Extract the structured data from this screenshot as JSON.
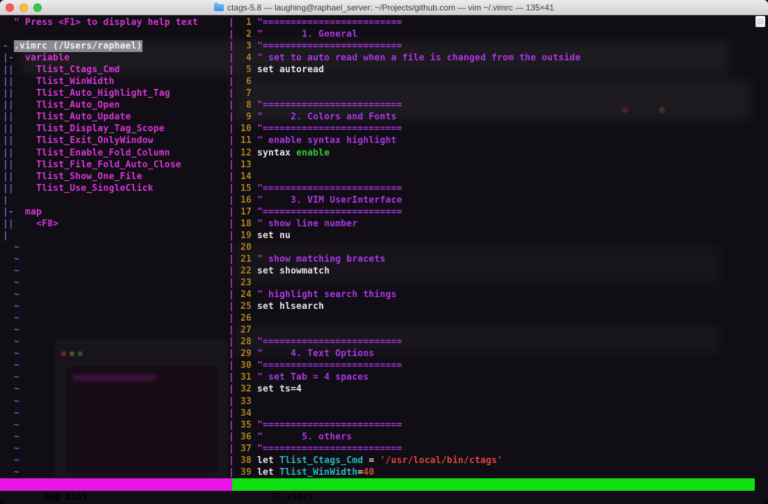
{
  "window": {
    "title": "ctags-5.8 — laughing@raphael_server: ~/Projects/github.com — vim ~/.vimrc — 135×41"
  },
  "colors": {
    "terminal_bg": "#100d14",
    "foreground": "#e8e5ea",
    "comment": "#ab38e4",
    "tag": "#d836d8",
    "line_number": "#a8811c",
    "green": "#2ed02e",
    "cyan": "#2cb8b8",
    "red": "#e0493c",
    "nontext": "#6f5bd6",
    "fold_column": "#7a5fd0",
    "divider": "#cf36d8",
    "file_highlight_bg": "#8e8a92",
    "status_taglist_bg": "#e816e8",
    "status_vimrc_bg": "#0fe00f"
  },
  "divider_char": "|",
  "taglist": {
    "rows": [
      {
        "fold": "",
        "text": "\" Press <F1> to display help text",
        "style": "comment"
      },
      {
        "fold": "",
        "text": "",
        "style": "tag"
      },
      {
        "fold": "-",
        "text": ".vimrc (/Users/raphael)",
        "style": "file"
      },
      {
        "fold": "|-",
        "text": "  variable",
        "style": "tag"
      },
      {
        "fold": "||",
        "text": "    Tlist_Ctags_Cmd",
        "style": "tag"
      },
      {
        "fold": "||",
        "text": "    Tlist_WinWidth",
        "style": "tag"
      },
      {
        "fold": "||",
        "text": "    Tlist_Auto_Highlight_Tag",
        "style": "tag"
      },
      {
        "fold": "||",
        "text": "    Tlist_Auto_Open",
        "style": "tag"
      },
      {
        "fold": "||",
        "text": "    Tlist_Auto_Update",
        "style": "tag"
      },
      {
        "fold": "||",
        "text": "    Tlist_Display_Tag_Scope",
        "style": "tag"
      },
      {
        "fold": "||",
        "text": "    Tlist_Exit_OnlyWindow",
        "style": "tag"
      },
      {
        "fold": "||",
        "text": "    Tlist_Enable_Fold_Column",
        "style": "tag"
      },
      {
        "fold": "||",
        "text": "    Tlist_File_Fold_Auto_Close",
        "style": "tag"
      },
      {
        "fold": "||",
        "text": "    Tlist_Show_One_File",
        "style": "tag"
      },
      {
        "fold": "||",
        "text": "    Tlist_Use_SingleClick",
        "style": "tag"
      },
      {
        "fold": "|",
        "text": "",
        "style": "tag"
      },
      {
        "fold": "|-",
        "text": "  map",
        "style": "tag"
      },
      {
        "fold": "||",
        "text": "    <F8>",
        "style": "tag"
      },
      {
        "fold": "|",
        "text": "",
        "style": "tag"
      }
    ],
    "empty_marker": "~",
    "empty_rows": 20
  },
  "editor": {
    "lines": [
      {
        "num": 1,
        "segments": [
          {
            "t": "\"=========================",
            "c": "cm"
          }
        ]
      },
      {
        "num": 2,
        "segments": [
          {
            "t": "\"       1. General",
            "c": "cm"
          }
        ]
      },
      {
        "num": 3,
        "segments": [
          {
            "t": "\"=========================",
            "c": "cm"
          }
        ]
      },
      {
        "num": 4,
        "segments": [
          {
            "t": "\" set to auto read when a file is changed from the outside",
            "c": "cm"
          }
        ]
      },
      {
        "num": 5,
        "segments": [
          {
            "t": "set autoread",
            "c": "tx"
          }
        ]
      },
      {
        "num": 6,
        "segments": []
      },
      {
        "num": 7,
        "segments": []
      },
      {
        "num": 8,
        "segments": [
          {
            "t": "\"=========================",
            "c": "cm"
          }
        ]
      },
      {
        "num": 9,
        "segments": [
          {
            "t": "\"     2. Colors and Fonts",
            "c": "cm"
          }
        ]
      },
      {
        "num": 10,
        "segments": [
          {
            "t": "\"=========================",
            "c": "cm"
          }
        ]
      },
      {
        "num": 11,
        "segments": [
          {
            "t": "\" enable syntax highlight",
            "c": "cm"
          }
        ]
      },
      {
        "num": 12,
        "segments": [
          {
            "t": "syntax ",
            "c": "tx"
          },
          {
            "t": "enable",
            "c": "gr"
          }
        ]
      },
      {
        "num": 13,
        "segments": []
      },
      {
        "num": 14,
        "segments": []
      },
      {
        "num": 15,
        "segments": [
          {
            "t": "\"=========================",
            "c": "cm"
          }
        ]
      },
      {
        "num": 16,
        "segments": [
          {
            "t": "\"     3. VIM UserInterface",
            "c": "cm"
          }
        ]
      },
      {
        "num": 17,
        "segments": [
          {
            "t": "\"=========================",
            "c": "cm"
          }
        ]
      },
      {
        "num": 18,
        "segments": [
          {
            "t": "\" show line number",
            "c": "cm"
          }
        ]
      },
      {
        "num": 19,
        "segments": [
          {
            "t": "set nu",
            "c": "tx"
          }
        ]
      },
      {
        "num": 20,
        "segments": []
      },
      {
        "num": 21,
        "segments": [
          {
            "t": "\" show matching bracets",
            "c": "cm"
          }
        ]
      },
      {
        "num": 22,
        "segments": [
          {
            "t": "set showmatch",
            "c": "tx"
          }
        ]
      },
      {
        "num": 23,
        "segments": []
      },
      {
        "num": 24,
        "segments": [
          {
            "t": "\" highlight search things",
            "c": "cm"
          }
        ]
      },
      {
        "num": 25,
        "segments": [
          {
            "t": "set hlsearch",
            "c": "tx"
          }
        ]
      },
      {
        "num": 26,
        "segments": []
      },
      {
        "num": 27,
        "segments": []
      },
      {
        "num": 28,
        "segments": [
          {
            "t": "\"=========================",
            "c": "cm"
          }
        ]
      },
      {
        "num": 29,
        "segments": [
          {
            "t": "\"     4. Text Options",
            "c": "cm"
          }
        ]
      },
      {
        "num": 30,
        "segments": [
          {
            "t": "\"=========================",
            "c": "cm"
          }
        ]
      },
      {
        "num": 31,
        "segments": [
          {
            "t": "\" set Tab = 4 spaces",
            "c": "cm"
          }
        ]
      },
      {
        "num": 32,
        "segments": [
          {
            "t": "set ts=4",
            "c": "tx"
          }
        ]
      },
      {
        "num": 33,
        "segments": []
      },
      {
        "num": 34,
        "segments": []
      },
      {
        "num": 35,
        "segments": [
          {
            "t": "\"=========================",
            "c": "cm"
          }
        ]
      },
      {
        "num": 36,
        "segments": [
          {
            "t": "\"       5. others",
            "c": "cm"
          }
        ]
      },
      {
        "num": 37,
        "segments": [
          {
            "t": "\"=========================",
            "c": "cm"
          }
        ]
      },
      {
        "num": 38,
        "segments": [
          {
            "t": "let ",
            "c": "tx"
          },
          {
            "t": "Tlist_Ctags_Cmd",
            "c": "cy"
          },
          {
            "t": " = ",
            "c": "tx"
          },
          {
            "t": "'/usr/local/bin/ctags'",
            "c": "rd"
          }
        ]
      },
      {
        "num": 39,
        "segments": [
          {
            "t": "let ",
            "c": "tx"
          },
          {
            "t": "Tlist_WinWidth",
            "c": "cy"
          },
          {
            "t": "=",
            "c": "tx"
          },
          {
            "t": "40",
            "c": "rd"
          }
        ]
      }
    ]
  },
  "statusbar": {
    "left": "Tag List",
    "right": "~/.vimrc"
  }
}
